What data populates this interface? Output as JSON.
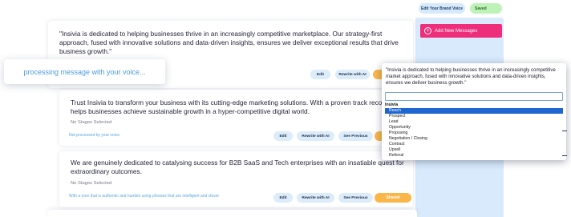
{
  "top_bar": {
    "edit_brand_voice": "Edit Your Brand Voice",
    "saved": "Saved"
  },
  "sidebar": {
    "add_new_messages": "Add New Messages"
  },
  "toast": {
    "text": "processing message with your voice..."
  },
  "cards": [
    {
      "text": "\"Insivia is dedicated to helping businesses thrive in an increasingly competitive marketplace. Our strategy-first approach, fused with innovative solutions and data-driven insights, ensures we deliver exceptional results that drive business growth.\"",
      "buttons": {
        "edit": "Edit",
        "rewrite": "Rewrite with AI"
      }
    },
    {
      "text": "Trust Insivia to transform your business with its cutting-edge marketing solutions. With a proven track record, it helps businesses achieve sustainable growth in a hyper-competitive digital world.",
      "stages": "No Stages Selected",
      "voice": "Not processed by your voice.",
      "buttons": {
        "edit": "Edit",
        "rewrite": "Rewrite with AI",
        "see_previous": "See Previous"
      }
    },
    {
      "text": "We are genuinely dedicated to catalysing success for B2B SaaS and Tech enterprises with an insatiable quest for extraordinary outcomes.",
      "stages": "No Stages Selected",
      "voice": "With a tone that is authentic and humble using phrases that are intelligent and clever",
      "buttons": {
        "edit": "Edit",
        "rewrite": "Rewrite with AI",
        "see_previous": "See Previous",
        "shared": "Shared"
      }
    }
  ],
  "popover": {
    "text": "\"Insivia is dedicated to helping businesses thrive in an increasingly competitive market approach, fused with innovative solutions and data-driven insights, ensures we deliver business growth.\"",
    "group": "Insivia",
    "options": [
      "Reach",
      "Prospect",
      "Lead",
      "Opportunity",
      "Proposing",
      "Negotiation / Closing",
      "Contract",
      "Upsell",
      "Referral"
    ],
    "selected": "Reach"
  },
  "colors": {
    "accent_pink": "#ee2d7b",
    "light_blue": "#d8eafc",
    "orange": "#fbb64a",
    "saved_green": "#bff2b8",
    "selected_blue": "#1e66d0",
    "toast_text": "#4a9be0"
  }
}
